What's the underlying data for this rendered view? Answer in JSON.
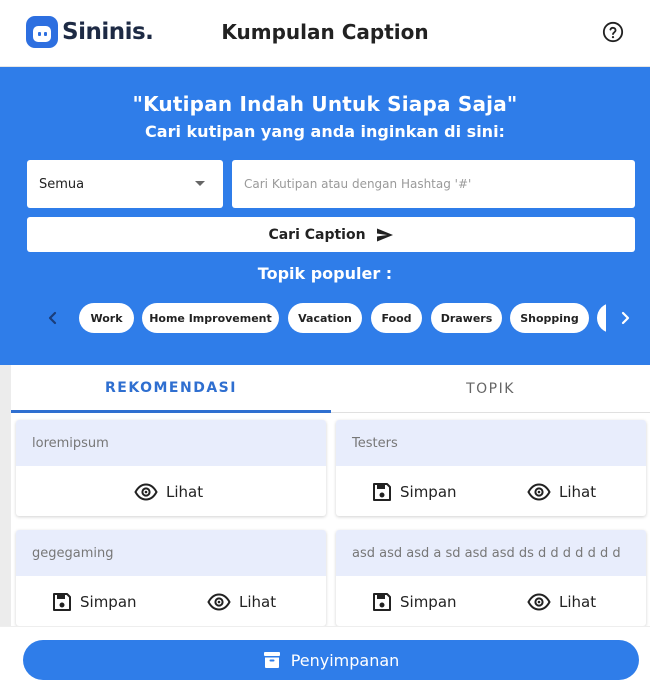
{
  "header": {
    "logo_text": "Sininis.",
    "title": "Kumpulan Caption",
    "help_icon": "help-circle-icon"
  },
  "hero": {
    "title": "\"Kutipan Indah Untuk Siapa Saja\"",
    "subtitle": "Cari kutipan yang anda inginkan di sini:",
    "select_value": "Semua",
    "search_placeholder": "Cari Kutipan atau dengan Hashtag '#'",
    "search_button_label": "Cari Caption",
    "topics_label": "Topik populer :",
    "chips": [
      "Work",
      "Home Improvement",
      "Vacation",
      "Food",
      "Drawers",
      "Shopping",
      ""
    ]
  },
  "tabs": {
    "recommend": "REKOMENDASI",
    "topics": "TOPIK"
  },
  "cards": [
    {
      "title": "loremipsum",
      "save_label": "",
      "view_label": "Lihat"
    },
    {
      "title": "Testers",
      "save_label": "Simpan",
      "view_label": "Lihat"
    },
    {
      "title": "gegegaming",
      "save_label": "Simpan",
      "view_label": "Lihat"
    },
    {
      "title": "asd asd asd a sd asd asd ds d d d d d d d",
      "save_label": "Simpan",
      "view_label": "Lihat"
    }
  ],
  "footer": {
    "save_all_label": "Penyimpanan"
  },
  "colors": {
    "primary": "#2f7de9",
    "tab_active": "#2f6fd0",
    "card_head": "#e8edfc"
  }
}
